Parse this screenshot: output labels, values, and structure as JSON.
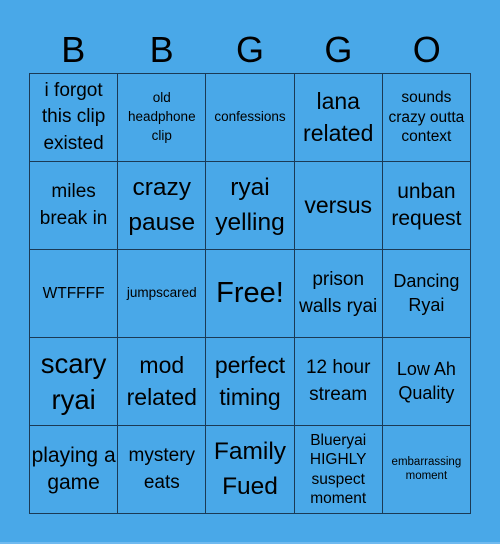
{
  "header": {
    "letters": [
      "B",
      "B",
      "G",
      "G",
      "O"
    ]
  },
  "board": {
    "cells": [
      "i forgot this clip existed",
      "old headphone clip",
      "confessions",
      "lana related",
      "sounds crazy outta context",
      "miles break in",
      "crazy pause",
      "ryai yelling",
      "versus",
      "unban request",
      "WTFFFF",
      "jumpscared",
      "Free!",
      "prison walls ryai",
      "Dancing Ryai",
      "scary ryai",
      "mod related",
      "perfect timing",
      "12 hour stream",
      "Low Ah Quality",
      "playing a game",
      "mystery eats",
      "Family Fued",
      "Blueryai HIGHLY suspect moment",
      "embarrassing moment"
    ],
    "free_space": "Free!"
  },
  "colors": {
    "background": "#49a8e8",
    "grid_line": "#1b3a55",
    "text": "#000000"
  }
}
